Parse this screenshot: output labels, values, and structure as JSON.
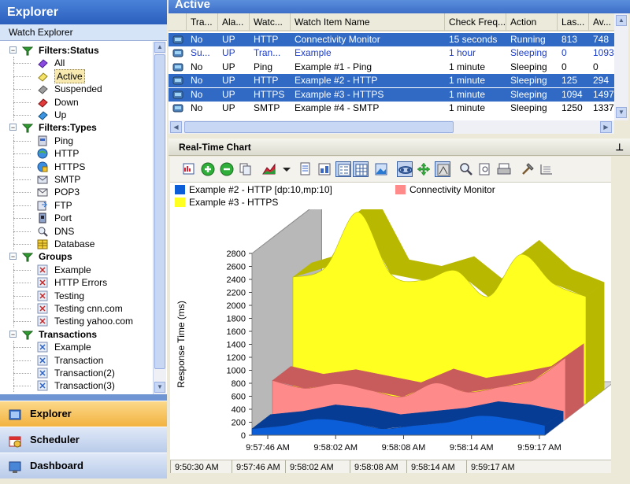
{
  "left_panel": {
    "title": "Explorer",
    "subtitle": "Watch Explorer",
    "tree": [
      {
        "label": "Filters:Status",
        "level": 0,
        "bold": true,
        "icon": "filter-icon",
        "expand": "−"
      },
      {
        "label": "All",
        "level": 1,
        "icon": "all-icon"
      },
      {
        "label": "Active",
        "level": 1,
        "icon": "active-icon",
        "selected": true
      },
      {
        "label": "Suspended",
        "level": 1,
        "icon": "suspended-icon"
      },
      {
        "label": "Down",
        "level": 1,
        "icon": "down-icon"
      },
      {
        "label": "Up",
        "level": 1,
        "icon": "up-icon"
      },
      {
        "label": "Filters:Types",
        "level": 0,
        "bold": true,
        "icon": "filter-icon",
        "expand": "−"
      },
      {
        "label": "Ping",
        "level": 1,
        "icon": "ping-icon"
      },
      {
        "label": "HTTP",
        "level": 1,
        "icon": "http-icon"
      },
      {
        "label": "HTTPS",
        "level": 1,
        "icon": "https-icon"
      },
      {
        "label": "SMTP",
        "level": 1,
        "icon": "smtp-icon"
      },
      {
        "label": "POP3",
        "level": 1,
        "icon": "pop3-icon"
      },
      {
        "label": "FTP",
        "level": 1,
        "icon": "ftp-icon"
      },
      {
        "label": "Port",
        "level": 1,
        "icon": "port-icon"
      },
      {
        "label": "DNS",
        "level": 1,
        "icon": "dns-icon"
      },
      {
        "label": "Database",
        "level": 1,
        "icon": "database-icon"
      },
      {
        "label": "Groups",
        "level": 0,
        "bold": true,
        "icon": "filter-icon",
        "expand": "−"
      },
      {
        "label": "Example",
        "level": 1,
        "icon": "group-icon"
      },
      {
        "label": "HTTP Errors",
        "level": 1,
        "icon": "group-icon"
      },
      {
        "label": "Testing",
        "level": 1,
        "icon": "group-icon"
      },
      {
        "label": "Testing cnn.com",
        "level": 1,
        "icon": "group-icon"
      },
      {
        "label": "Testing yahoo.com",
        "level": 1,
        "icon": "group-icon"
      },
      {
        "label": "Transactions",
        "level": 0,
        "bold": true,
        "icon": "filter-icon",
        "expand": "−"
      },
      {
        "label": "Example",
        "level": 1,
        "icon": "transaction-icon"
      },
      {
        "label": "Transaction",
        "level": 1,
        "icon": "transaction-icon"
      },
      {
        "label": "Transaction(2)",
        "level": 1,
        "icon": "transaction-icon"
      },
      {
        "label": "Transaction(3)",
        "level": 1,
        "icon": "transaction-icon"
      }
    ],
    "nav": [
      {
        "label": "Explorer",
        "icon": "explorer-icon",
        "active": true
      },
      {
        "label": "Scheduler",
        "icon": "scheduler-icon"
      },
      {
        "label": "Dashboard",
        "icon": "dashboard-icon"
      }
    ]
  },
  "active_panel": {
    "title": "Active",
    "columns": [
      "",
      "Tra...",
      "Ala...",
      "Watc...",
      "Watch Item Name",
      "Check Freq...",
      "Action",
      "Las...",
      "Av..."
    ],
    "rows": [
      {
        "selected": true,
        "cells": [
          "No",
          "UP",
          "HTTP",
          "Connectivity Monitor",
          "15 seconds",
          "Running",
          "813",
          "748"
        ]
      },
      {
        "blue": true,
        "cells": [
          "Su...",
          "UP",
          "Tran...",
          "Example",
          "1 hour",
          "Sleeping",
          "0",
          "1093"
        ]
      },
      {
        "cells": [
          "No",
          "UP",
          "Ping",
          "Example #1 - Ping",
          "1 minute",
          "Sleeping",
          "0",
          "0"
        ]
      },
      {
        "selected": true,
        "cells": [
          "No",
          "UP",
          "HTTP",
          "Example #2 - HTTP",
          "1 minute",
          "Sleeping",
          "125",
          "294"
        ]
      },
      {
        "selected": true,
        "cells": [
          "No",
          "UP",
          "HTTPS",
          "Example #3 - HTTPS",
          "1 minute",
          "Sleeping",
          "1094",
          "1497"
        ]
      },
      {
        "cells": [
          "No",
          "UP",
          "SMTP",
          "Example #4 - SMTP",
          "1 minute",
          "Sleeping",
          "1250",
          "1337"
        ]
      }
    ]
  },
  "chart_panel": {
    "title": "Real-Time Chart",
    "pin_glyph": "⊥",
    "toolbar_icons": [
      "chart-properties-icon",
      "add-series-icon",
      "remove-series-icon",
      "copy-icon",
      "chart-type-icon",
      "dropdown-icon",
      "data-view-icon",
      "data-table-icon",
      "legend-icon",
      "grid-icon",
      "image-icon",
      "3d-view-icon",
      "rotate-icon",
      "clustered-icon",
      "zoom-icon",
      "zoom-fit-icon",
      "print-icon",
      "tools-icon",
      "axis-settings-icon"
    ],
    "bottom_axis_labels": [
      "9:50:30 AM",
      "9:57:46 AM",
      "9:58:02 AM",
      "9:58:08 AM",
      "9:58:14 AM",
      "9:59:17 AM"
    ]
  },
  "chart_data": {
    "type": "area",
    "title": "",
    "ylabel": "Response Time (ms)",
    "xlabel": "",
    "ylim": [
      0,
      2800
    ],
    "yticks": [
      0,
      200,
      400,
      600,
      800,
      1000,
      1200,
      1400,
      1600,
      1800,
      2000,
      2200,
      2400,
      2600,
      2800
    ],
    "categories": [
      "9:57:46 AM",
      "9:58:02 AM",
      "9:58:08 AM",
      "9:58:14 AM",
      "9:59:17 AM"
    ],
    "legend_position": "top",
    "series": [
      {
        "name": "Example #2 - HTTP [dp:10,mp:10]",
        "color": "#0c5ed8",
        "x": [
          0,
          0.5,
          1,
          1.5,
          2,
          2.5,
          3,
          3.5,
          4,
          4.5
        ],
        "values": [
          100,
          150,
          250,
          200,
          100,
          150,
          200,
          300,
          250,
          150
        ]
      },
      {
        "name": "Connectivity Monitor",
        "color": "#ff8a8a",
        "x": [
          0,
          0.5,
          1,
          1.5,
          2,
          2.5,
          3,
          3.5,
          4,
          4.5
        ],
        "values": [
          600,
          480,
          550,
          450,
          350,
          560,
          420,
          500,
          600,
          950
        ]
      },
      {
        "name": "Example #3 - HTTPS",
        "color": "#ffff20",
        "x": [
          0,
          0.5,
          1,
          1.5,
          2,
          2.5,
          3,
          3.5,
          4,
          4.5
        ],
        "values": [
          1950,
          2100,
          2950,
          2000,
          1900,
          2050,
          1650,
          2300,
          1850,
          1650
        ]
      }
    ]
  }
}
